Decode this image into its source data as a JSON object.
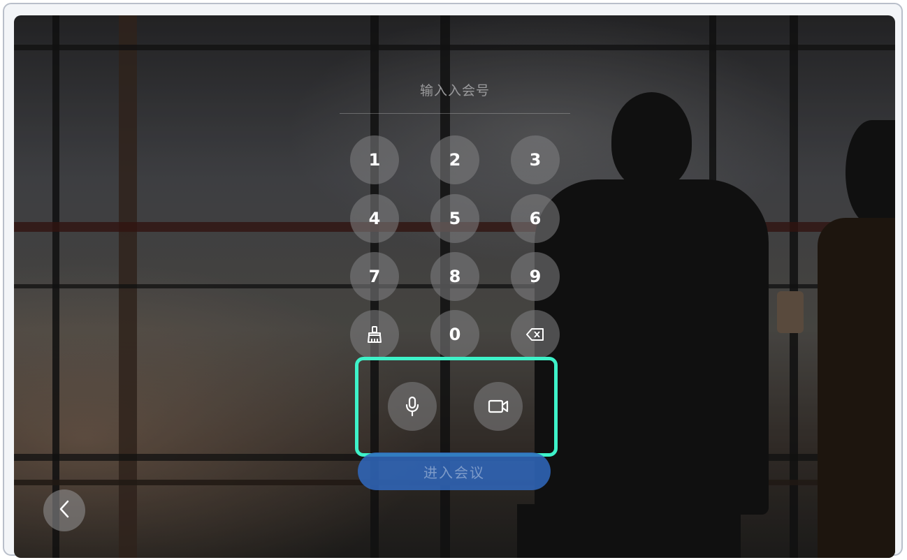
{
  "meeting_input": {
    "placeholder": "输入入会号"
  },
  "keypad": {
    "keys": [
      "1",
      "2",
      "3",
      "4",
      "5",
      "6",
      "7",
      "8",
      "9",
      "0"
    ],
    "clear_icon": "broom-icon",
    "backspace_icon": "backspace-icon"
  },
  "media_toggles": {
    "mic_icon": "microphone-icon",
    "camera_icon": "video-camera-icon"
  },
  "join_button": {
    "label": "进入会议"
  },
  "back_icon": "chevron-left-icon",
  "colors": {
    "highlight": "#3ef2c9",
    "join_button": "#3068be"
  }
}
